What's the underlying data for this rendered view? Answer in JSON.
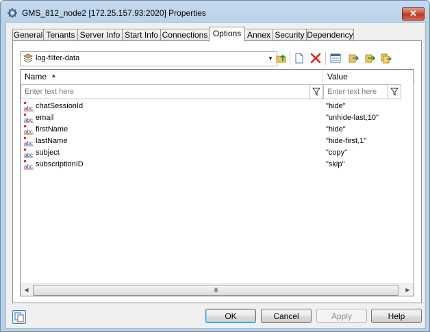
{
  "window": {
    "title": "GMS_812_node2 [172.25.157.93:2020] Properties",
    "close_label": "✕"
  },
  "tabs": [
    {
      "label": "General"
    },
    {
      "label": "Tenants"
    },
    {
      "label": "Server Info"
    },
    {
      "label": "Start Info"
    },
    {
      "label": "Connections"
    },
    {
      "label": "Options"
    },
    {
      "label": "Annex"
    },
    {
      "label": "Security"
    },
    {
      "label": "Dependency"
    }
  ],
  "active_tab": "Options",
  "section_combo": {
    "value": "log-filter-data",
    "icon": "section-stack-icon"
  },
  "toolbar": {
    "icons": [
      "folder-up-icon",
      "new-document-icon",
      "delete-icon",
      "properties-icon",
      "export-icon",
      "import-icon",
      "copy-export-icon"
    ],
    "delete_color": "#d9261c"
  },
  "grid": {
    "columns": [
      {
        "label": "Name",
        "sort": "ascending"
      },
      {
        "label": "Value"
      }
    ],
    "filter_placeholder_name": "Enter text here",
    "filter_placeholder_value": "Enter text here",
    "rows": [
      {
        "name": "chatSessionId",
        "value": "\"hide\""
      },
      {
        "name": "email",
        "value": "\"unhide-last,10\""
      },
      {
        "name": "firstName",
        "value": "\"hide\""
      },
      {
        "name": "lastName",
        "value": "\"hide-first,1\""
      },
      {
        "name": "subject",
        "value": "\"copy\""
      },
      {
        "name": "subscriptionID",
        "value": "\"skip\""
      }
    ],
    "row_icon": "abc-text-option-icon",
    "scroll_grip": "III"
  },
  "buttons": {
    "ok": "OK",
    "cancel": "Cancel",
    "apply": "Apply",
    "help": "Help"
  }
}
